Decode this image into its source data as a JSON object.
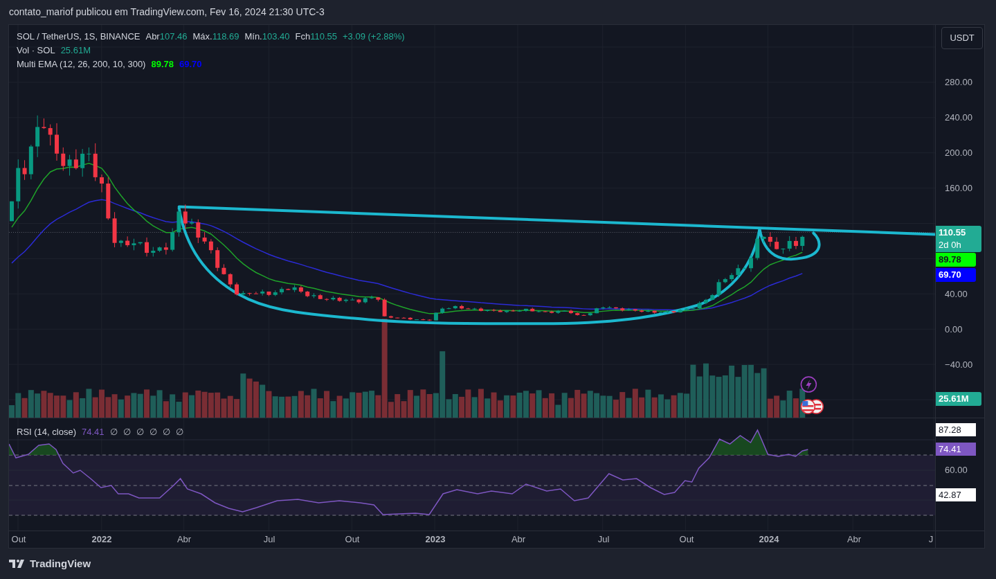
{
  "header": {
    "text": "contato_mariof publicou em TradingView.com, Fev 16, 2024 21:30 UTC-3"
  },
  "legend": {
    "symbol": "SOL / TetherUS, 1S, BINANCE",
    "ohlc": [
      {
        "label": "Abr",
        "value": "107.46"
      },
      {
        "label": "Máx.",
        "value": "118.69"
      },
      {
        "label": "Mín.",
        "value": "103.40"
      },
      {
        "label": "Fch",
        "value": "110.55"
      }
    ],
    "change": "+3.09 (+2.88%)"
  },
  "volume_legend": {
    "label": "Vol · SOL",
    "value": "25.61M"
  },
  "ema_legend": {
    "label": "Multi EMA (12, 26, 200, 10, 300)",
    "values": [
      {
        "text": "89.78",
        "color": "#00ff00"
      },
      {
        "text": "69.70",
        "color": "#0000ff"
      }
    ]
  },
  "currency_button": {
    "label": "USDT"
  },
  "price_axis": {
    "ticks": [
      "280.00",
      "240.00",
      "200.00",
      "160.00",
      "40.00",
      "0.00",
      "−40.00"
    ]
  },
  "price_badges": [
    {
      "kind": "last",
      "value": "110.55",
      "countdown": "2d 0h",
      "color": "#22ab94"
    },
    {
      "kind": "ema",
      "value": "89.78",
      "color": "#00ff00"
    },
    {
      "kind": "ema",
      "value": "69.70",
      "color": "#0000ff"
    },
    {
      "kind": "volume",
      "value": "25.61M",
      "color": "#22ab94"
    }
  ],
  "rsi": {
    "label": "RSI (14, close)",
    "value": "74.41",
    "empty_values": [
      "∅",
      "∅",
      "∅",
      "∅",
      "∅",
      "∅"
    ],
    "ticks": [
      "60.00"
    ],
    "badges": [
      {
        "kind": "upper",
        "value": "87.28",
        "color": "#ffffff"
      },
      {
        "kind": "last",
        "value": "74.41",
        "color": "#7e57c2"
      },
      {
        "kind": "lower",
        "value": "42.87",
        "color": "#ffffff"
      }
    ]
  },
  "time_axis": {
    "labels": [
      {
        "text": "Out",
        "kind": "month"
      },
      {
        "text": "2022",
        "kind": "year"
      },
      {
        "text": "Abr",
        "kind": "month"
      },
      {
        "text": "Jul",
        "kind": "month"
      },
      {
        "text": "Out",
        "kind": "month"
      },
      {
        "text": "2023",
        "kind": "year"
      },
      {
        "text": "Abr",
        "kind": "month"
      },
      {
        "text": "Jul",
        "kind": "month"
      },
      {
        "text": "Out",
        "kind": "month"
      },
      {
        "text": "2024",
        "kind": "year"
      },
      {
        "text": "Abr",
        "kind": "month"
      },
      {
        "text": "J",
        "kind": "month"
      }
    ]
  },
  "footer": {
    "brand": "TradingView"
  }
}
